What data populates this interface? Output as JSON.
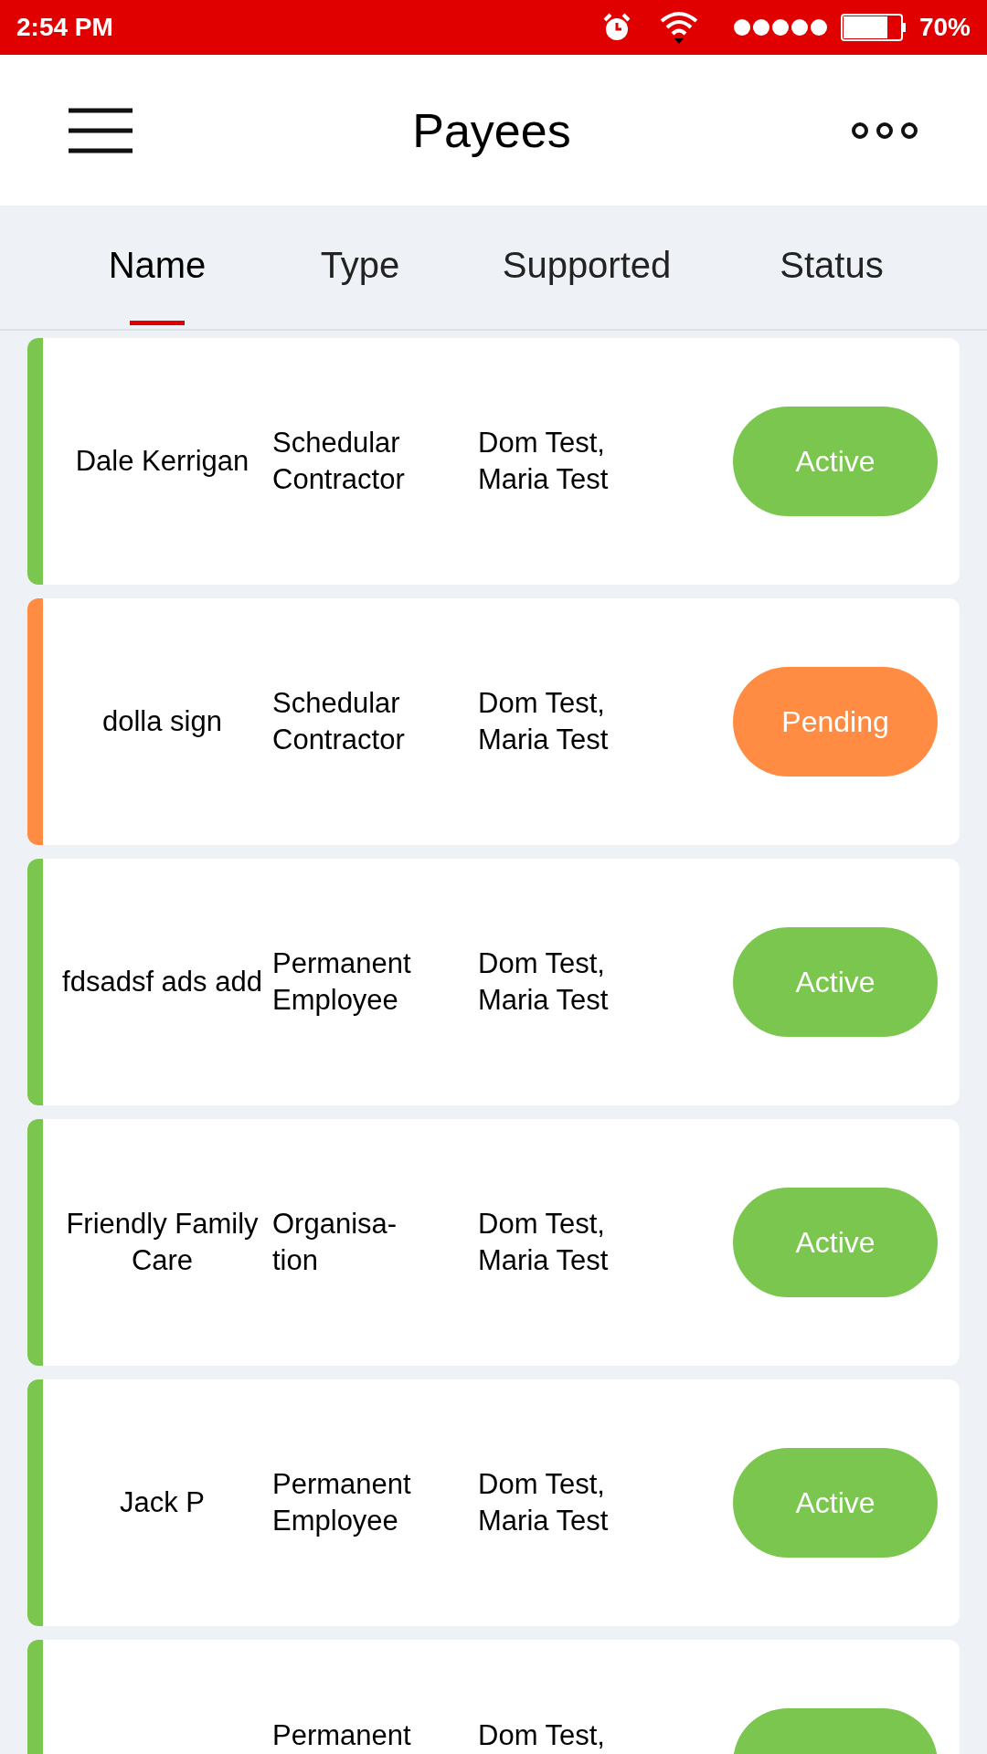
{
  "status_bar": {
    "time": "2:54 PM",
    "battery": "70%"
  },
  "header": {
    "title": "Payees"
  },
  "tabs": [
    {
      "label": "Name",
      "selected": true
    },
    {
      "label": "Type",
      "selected": false
    },
    {
      "label": "Supported",
      "selected": false
    },
    {
      "label": "Status",
      "selected": false
    }
  ],
  "payees": [
    {
      "name": "Dale Kerrigan",
      "type": "Schedular Contractor",
      "supported": "Dom Test, Maria Test",
      "status": "Active",
      "color": "#7ac64f"
    },
    {
      "name": "dolla sign",
      "type": "Schedular Contractor",
      "supported": "Dom Test, Maria Test",
      "status": "Pending",
      "color": "#ff8c42"
    },
    {
      "name": "fdsadsf ads add",
      "type": "Permanent Employee",
      "supported": "Dom Test, Maria Test",
      "status": "Active",
      "color": "#7ac64f"
    },
    {
      "name": "Friendly Family Care",
      "type": "Organisa- tion",
      "supported": "Dom Test, Maria Test",
      "status": "Active",
      "color": "#7ac64f"
    },
    {
      "name": "Jack  P",
      "type": "Permanent Employee",
      "supported": "Dom Test, Maria Test",
      "status": "Active",
      "color": "#7ac64f"
    }
  ],
  "partial_payee": {
    "type": "Permanent",
    "supported": "Dom Test,",
    "color": "#7ac64f"
  }
}
